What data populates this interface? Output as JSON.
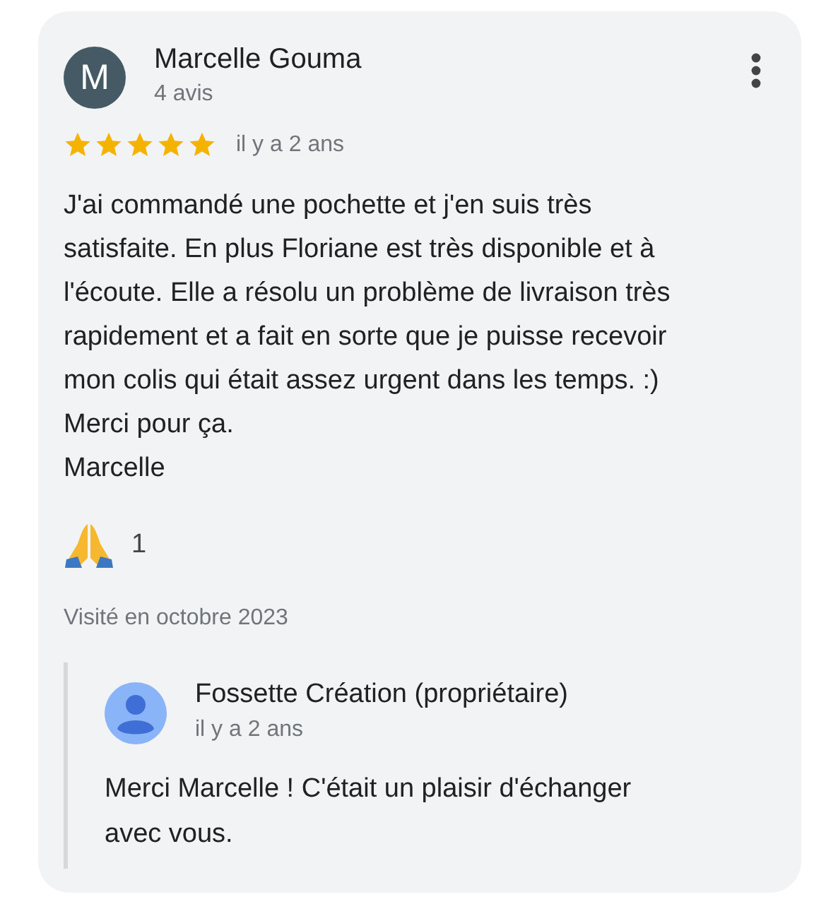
{
  "review": {
    "avatar_letter": "M",
    "author": "Marcelle Gouma",
    "review_count": "4 avis",
    "stars": 5,
    "date": "il y a 2 ans",
    "text": "J'ai commandé une pochette et j'en suis très satisfaite. En plus Floriane est très disponible et à l'écoute. Elle a résolu un problème de livraison très rapidement et a fait en sorte que je puisse recevoir mon colis qui était assez urgent dans les temps. :)\nMerci pour ça.\nMarcelle",
    "reaction_count": "1",
    "visited": "Visité en octobre 2023"
  },
  "reply": {
    "author": "Fossette Création (propriétaire)",
    "date": "il y a 2 ans",
    "text": "Merci Marcelle ! C'était un plaisir d'échanger avec vous."
  }
}
